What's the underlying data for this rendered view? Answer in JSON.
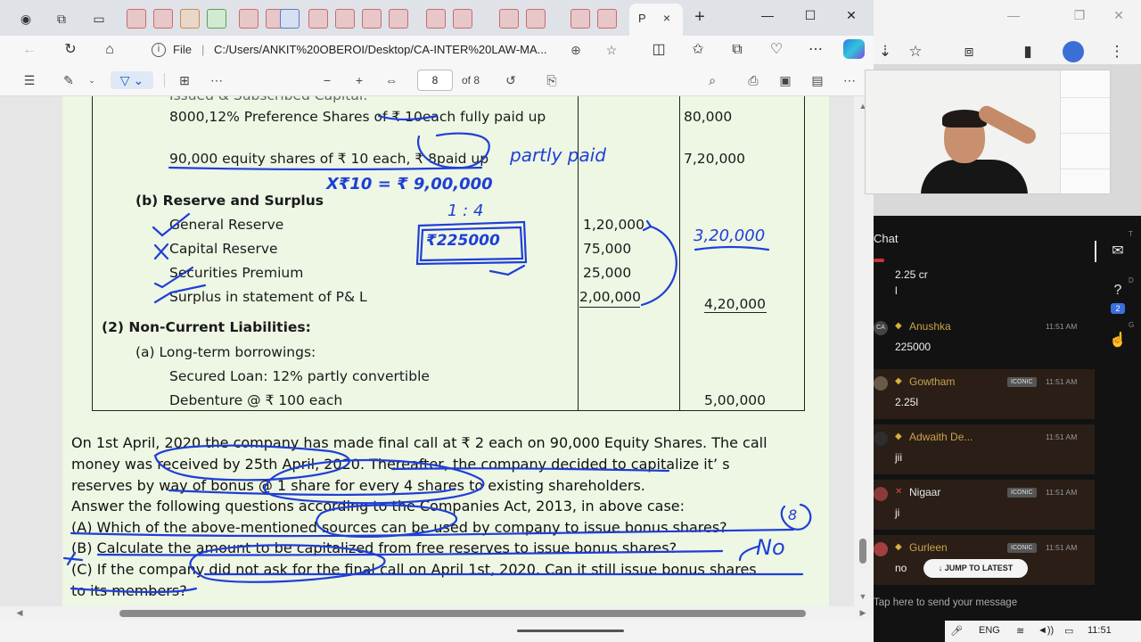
{
  "browser": {
    "active_tab_label": "P",
    "tab_close": "×",
    "new_tab": "+",
    "window_controls": {
      "minimize": "—",
      "maximize": "☐",
      "close": "✕"
    },
    "address": {
      "scheme_label": "File",
      "url": "C:/Users/ANKIT%20OBEROI/Desktop/CA-INTER%20LAW-MA..."
    }
  },
  "pdf_toolbar": {
    "current_page": "8",
    "page_total": "of 8"
  },
  "document": {
    "rows": [
      {
        "label": "8000,12% Preference Shares of ₹ 10each fully paid up",
        "col2": "",
        "col3": "80,000"
      },
      {
        "label": "90,000 equity shares of ₹ 10 each, ₹ 8paid up",
        "col2": "",
        "col3": "7,20,000"
      },
      {
        "label": "(b)   Reserve and Surplus",
        "col2": "",
        "col3": ""
      },
      {
        "label": "General Reserve",
        "col2": "1,20,000",
        "col3": ""
      },
      {
        "label": "Capital Reserve",
        "col2": "75,000",
        "col3": ""
      },
      {
        "label": "Securities Premium",
        "col2": "25,000",
        "col3": ""
      },
      {
        "label": "Surplus in statement of P& L",
        "col2": "2,00,000",
        "col3": "4,20,000"
      },
      {
        "label": "(2)   Non-Current  Liabilities:",
        "col2": "",
        "col3": ""
      },
      {
        "label": "(a)    Long-term borrowings:",
        "col2": "",
        "col3": ""
      },
      {
        "label": "Secured Loan: 12% partly convertible",
        "col2": "",
        "col3": ""
      },
      {
        "label": "Debenture @ ₹ 100 each",
        "col2": "",
        "col3": "5,00,000"
      }
    ],
    "top_cut_label": "Issued & Subscribed Capital:",
    "paragraph": [
      "On 1st April, 2020 the company has made final call at ₹ 2 each on 90,000 Equity Shares. The call",
      "money was received by 25th April, 2020. Thereafter, the company decided to capitalize it’ s",
      "reserves by way of bonus @ 1 share for every 4 shares to existing shareholders.",
      "Answer the following questions according to the Companies Act, 2013, in above case:",
      "(A) Which of the above-mentioned sources can be used by company to issue bonus shares?",
      "(B) Calculate the amount to be capitalized from free reserves to issue bonus shares?",
      "(C) If the company did not ask for the final call on April 1st, 2020. Can it still issue bonus shares",
      "to its members?"
    ],
    "ink": {
      "partly_paid": "partly paid",
      "calc": "X₹10 = ₹ 9,00,000",
      "ratio": "1 : 4",
      "boxed": "₹225000",
      "total": "3,20,000",
      "answer_a": "8",
      "answer_c": "No"
    }
  },
  "chat": {
    "title": "Chat",
    "top_message": {
      "line1": "2.25 cr",
      "line2": "l"
    },
    "messages": [
      {
        "name": "Anushka",
        "badge": "",
        "time": "11:51 AM",
        "text": "225000",
        "avatar": "CA"
      },
      {
        "name": "Gowtham",
        "badge": "ICONIC",
        "time": "11:51 AM",
        "text": "2.25l",
        "avatar": ""
      },
      {
        "name": "Adwaith De...",
        "badge": "",
        "time": "11:51 AM",
        "text": "jii",
        "avatar": ""
      },
      {
        "name": "Nigaar",
        "badge": "ICONIC",
        "time": "11:51 AM",
        "text": "ji",
        "avatar": ""
      },
      {
        "name": "Gurleen",
        "badge": "ICONIC",
        "time": "11:51 AM",
        "text": "no",
        "avatar": ""
      }
    ],
    "jump_label": "↓ JUMP TO LATEST",
    "input_placeholder": "Tap here to send your message",
    "side_badge": "2",
    "side_letters": [
      "T",
      "D",
      "G"
    ]
  },
  "taskbar": {
    "lang": "ENG",
    "time": "11:51"
  },
  "colors": {
    "ink_blue": "#1e3fd6",
    "page_bg": "#eef6e4",
    "chat_gold": "#c9a24a"
  }
}
